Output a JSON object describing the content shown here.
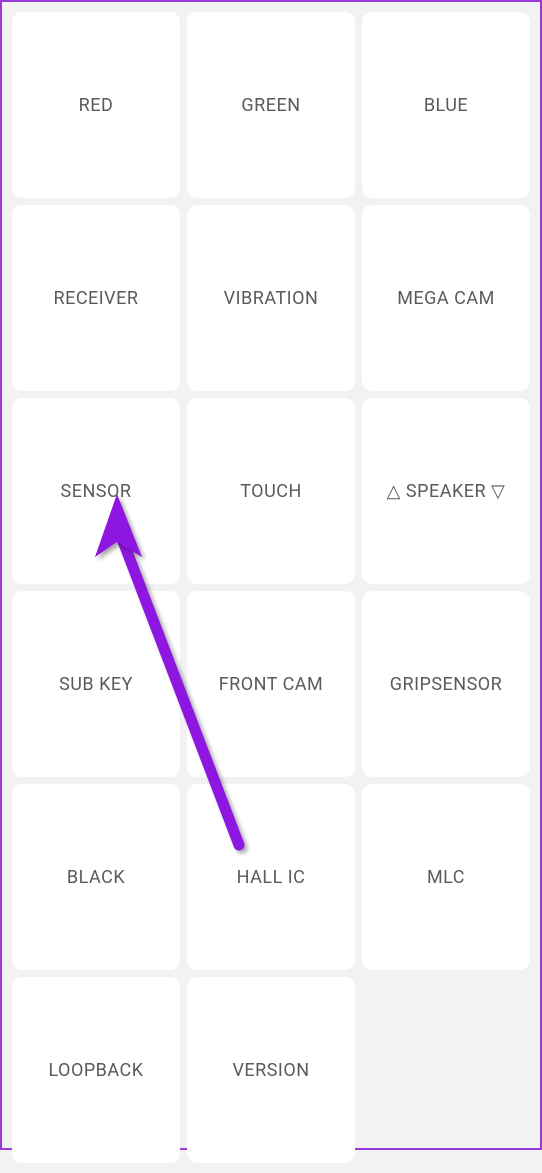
{
  "grid": {
    "tiles": [
      {
        "label": "RED",
        "name": "tile-red"
      },
      {
        "label": "GREEN",
        "name": "tile-green"
      },
      {
        "label": "BLUE",
        "name": "tile-blue"
      },
      {
        "label": "RECEIVER",
        "name": "tile-receiver"
      },
      {
        "label": "VIBRATION",
        "name": "tile-vibration"
      },
      {
        "label": "MEGA CAM",
        "name": "tile-mega-cam"
      },
      {
        "label": "SENSOR",
        "name": "tile-sensor"
      },
      {
        "label": "TOUCH",
        "name": "tile-touch"
      },
      {
        "label": "△ SPEAKER ▽",
        "name": "tile-speaker"
      },
      {
        "label": "SUB KEY",
        "name": "tile-sub-key"
      },
      {
        "label": "FRONT CAM",
        "name": "tile-front-cam"
      },
      {
        "label": "GRIPSENSOR",
        "name": "tile-gripsensor"
      },
      {
        "label": "BLACK",
        "name": "tile-black"
      },
      {
        "label": "HALL IC",
        "name": "tile-hall-ic"
      },
      {
        "label": "MLC",
        "name": "tile-mlc"
      },
      {
        "label": "LOOPBACK",
        "name": "tile-loopback"
      },
      {
        "label": "VERSION",
        "name": "tile-version"
      }
    ]
  },
  "annotation": {
    "arrow_target": "tile-sensor",
    "arrow_color": "#8d12e0"
  }
}
